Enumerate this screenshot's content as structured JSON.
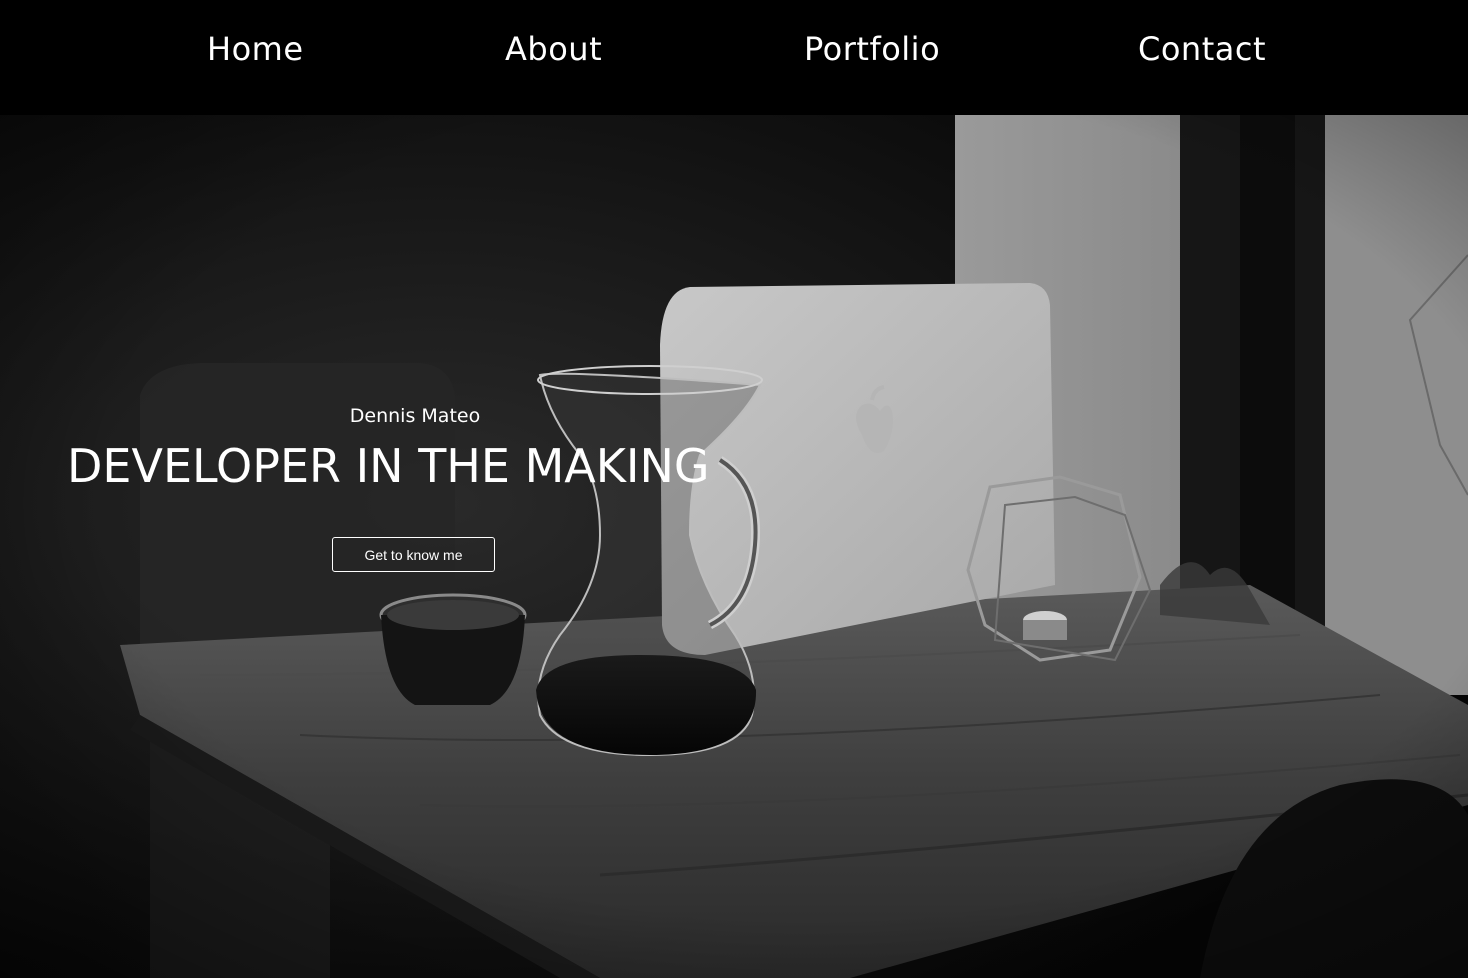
{
  "nav": {
    "items": [
      {
        "label": "Home"
      },
      {
        "label": "About"
      },
      {
        "label": "Portfolio"
      },
      {
        "label": "Contact"
      }
    ]
  },
  "hero": {
    "name": "Dennis Mateo",
    "title": "DEVELOPER IN THE MAKING",
    "button_label": "Get to know me"
  },
  "colors": {
    "nav_background": "#000000",
    "text": "#ffffff"
  }
}
